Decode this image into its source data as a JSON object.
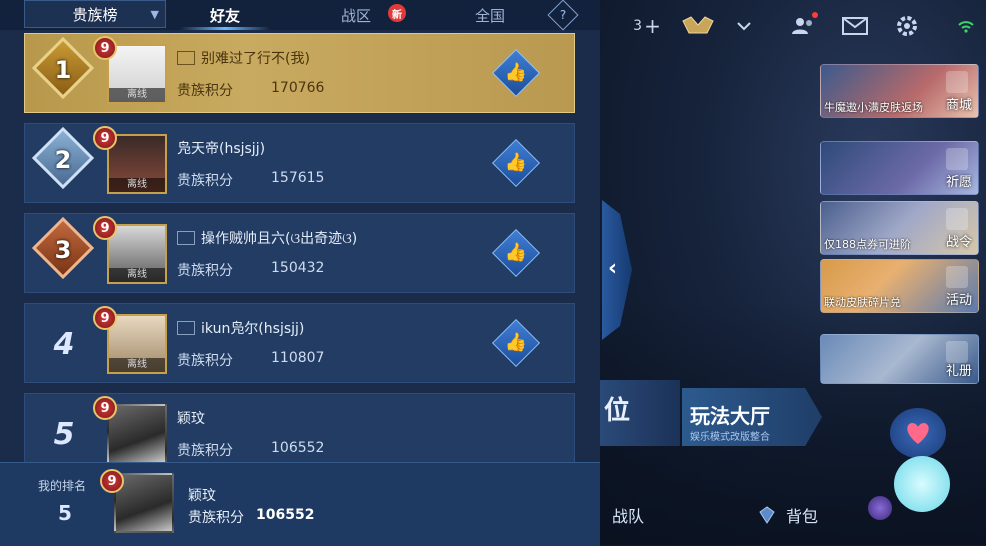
{
  "left_panel": {
    "dropdown_label": "贵族榜",
    "tabs": [
      {
        "label": "好友",
        "active": true
      },
      {
        "label": "战区",
        "badge": "新"
      },
      {
        "label": "全国"
      }
    ],
    "help_icon": "?",
    "rows": [
      {
        "rank": "1",
        "level": "9",
        "name": "别难过了行不(我)",
        "score_label": "贵族积分",
        "score": "170766",
        "status": "离线"
      },
      {
        "rank": "2",
        "level": "9",
        "name": "凫天帝(hsjsjj)",
        "score_label": "贵族积分",
        "score": "157615",
        "status": "离线"
      },
      {
        "rank": "3",
        "level": "9",
        "name": "操作贼帅且六(ଓ出奇迹ଓ)",
        "score_label": "贵族积分",
        "score": "150432",
        "status": "离线"
      },
      {
        "rank": "4",
        "level": "9",
        "name": "ikun凫尔(hsjsjj)",
        "score_label": "贵族积分",
        "score": "110807",
        "status": "离线"
      },
      {
        "rank": "5",
        "level": "9",
        "name": "颖玟",
        "score_label": "贵族积分",
        "score": "106552"
      }
    ],
    "my_rank": {
      "label": "我的排名",
      "rank": "5",
      "level": "9",
      "name": "颖玟",
      "score_label": "贵族积分",
      "score": "106552"
    }
  },
  "topbar": {
    "add_count": "3",
    "plus": "+"
  },
  "banners": [
    {
      "caption": "牛魔遨小满皮肤返场",
      "label": "商城"
    },
    {
      "caption": "",
      "label": "祈愿"
    },
    {
      "caption": "仅188点券可进阶",
      "label": "战令"
    },
    {
      "caption": "联动皮肤碎片兑",
      "label": "活动"
    },
    {
      "caption": "",
      "label": "礼册"
    }
  ],
  "modes": {
    "left_char": "位",
    "right_title": "玩法大厅",
    "right_sub": "娱乐模式改版整合"
  },
  "bottom": {
    "team": "战队",
    "bag": "背包"
  },
  "colors": {
    "panel": "#1a2c4a",
    "first_row": "#c8aa60",
    "accent": "#6ab8ff"
  }
}
